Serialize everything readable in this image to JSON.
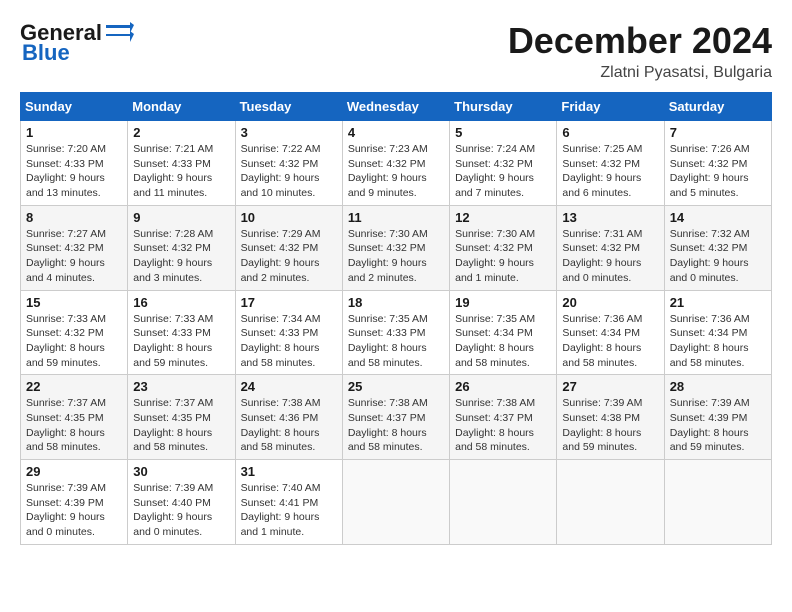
{
  "logo": {
    "line1": "General",
    "line2": "Blue"
  },
  "title": "December 2024",
  "location": "Zlatni Pyasatsi, Bulgaria",
  "days_of_week": [
    "Sunday",
    "Monday",
    "Tuesday",
    "Wednesday",
    "Thursday",
    "Friday",
    "Saturday"
  ],
  "weeks": [
    [
      {
        "day": "1",
        "info": "Sunrise: 7:20 AM\nSunset: 4:33 PM\nDaylight: 9 hours\nand 13 minutes."
      },
      {
        "day": "2",
        "info": "Sunrise: 7:21 AM\nSunset: 4:33 PM\nDaylight: 9 hours\nand 11 minutes."
      },
      {
        "day": "3",
        "info": "Sunrise: 7:22 AM\nSunset: 4:32 PM\nDaylight: 9 hours\nand 10 minutes."
      },
      {
        "day": "4",
        "info": "Sunrise: 7:23 AM\nSunset: 4:32 PM\nDaylight: 9 hours\nand 9 minutes."
      },
      {
        "day": "5",
        "info": "Sunrise: 7:24 AM\nSunset: 4:32 PM\nDaylight: 9 hours\nand 7 minutes."
      },
      {
        "day": "6",
        "info": "Sunrise: 7:25 AM\nSunset: 4:32 PM\nDaylight: 9 hours\nand 6 minutes."
      },
      {
        "day": "7",
        "info": "Sunrise: 7:26 AM\nSunset: 4:32 PM\nDaylight: 9 hours\nand 5 minutes."
      }
    ],
    [
      {
        "day": "8",
        "info": "Sunrise: 7:27 AM\nSunset: 4:32 PM\nDaylight: 9 hours\nand 4 minutes."
      },
      {
        "day": "9",
        "info": "Sunrise: 7:28 AM\nSunset: 4:32 PM\nDaylight: 9 hours\nand 3 minutes."
      },
      {
        "day": "10",
        "info": "Sunrise: 7:29 AM\nSunset: 4:32 PM\nDaylight: 9 hours\nand 2 minutes."
      },
      {
        "day": "11",
        "info": "Sunrise: 7:30 AM\nSunset: 4:32 PM\nDaylight: 9 hours\nand 2 minutes."
      },
      {
        "day": "12",
        "info": "Sunrise: 7:30 AM\nSunset: 4:32 PM\nDaylight: 9 hours\nand 1 minute."
      },
      {
        "day": "13",
        "info": "Sunrise: 7:31 AM\nSunset: 4:32 PM\nDaylight: 9 hours\nand 0 minutes."
      },
      {
        "day": "14",
        "info": "Sunrise: 7:32 AM\nSunset: 4:32 PM\nDaylight: 9 hours\nand 0 minutes."
      }
    ],
    [
      {
        "day": "15",
        "info": "Sunrise: 7:33 AM\nSunset: 4:32 PM\nDaylight: 8 hours\nand 59 minutes."
      },
      {
        "day": "16",
        "info": "Sunrise: 7:33 AM\nSunset: 4:33 PM\nDaylight: 8 hours\nand 59 minutes."
      },
      {
        "day": "17",
        "info": "Sunrise: 7:34 AM\nSunset: 4:33 PM\nDaylight: 8 hours\nand 58 minutes."
      },
      {
        "day": "18",
        "info": "Sunrise: 7:35 AM\nSunset: 4:33 PM\nDaylight: 8 hours\nand 58 minutes."
      },
      {
        "day": "19",
        "info": "Sunrise: 7:35 AM\nSunset: 4:34 PM\nDaylight: 8 hours\nand 58 minutes."
      },
      {
        "day": "20",
        "info": "Sunrise: 7:36 AM\nSunset: 4:34 PM\nDaylight: 8 hours\nand 58 minutes."
      },
      {
        "day": "21",
        "info": "Sunrise: 7:36 AM\nSunset: 4:34 PM\nDaylight: 8 hours\nand 58 minutes."
      }
    ],
    [
      {
        "day": "22",
        "info": "Sunrise: 7:37 AM\nSunset: 4:35 PM\nDaylight: 8 hours\nand 58 minutes."
      },
      {
        "day": "23",
        "info": "Sunrise: 7:37 AM\nSunset: 4:35 PM\nDaylight: 8 hours\nand 58 minutes."
      },
      {
        "day": "24",
        "info": "Sunrise: 7:38 AM\nSunset: 4:36 PM\nDaylight: 8 hours\nand 58 minutes."
      },
      {
        "day": "25",
        "info": "Sunrise: 7:38 AM\nSunset: 4:37 PM\nDaylight: 8 hours\nand 58 minutes."
      },
      {
        "day": "26",
        "info": "Sunrise: 7:38 AM\nSunset: 4:37 PM\nDaylight: 8 hours\nand 58 minutes."
      },
      {
        "day": "27",
        "info": "Sunrise: 7:39 AM\nSunset: 4:38 PM\nDaylight: 8 hours\nand 59 minutes."
      },
      {
        "day": "28",
        "info": "Sunrise: 7:39 AM\nSunset: 4:39 PM\nDaylight: 8 hours\nand 59 minutes."
      }
    ],
    [
      {
        "day": "29",
        "info": "Sunrise: 7:39 AM\nSunset: 4:39 PM\nDaylight: 9 hours\nand 0 minutes."
      },
      {
        "day": "30",
        "info": "Sunrise: 7:39 AM\nSunset: 4:40 PM\nDaylight: 9 hours\nand 0 minutes."
      },
      {
        "day": "31",
        "info": "Sunrise: 7:40 AM\nSunset: 4:41 PM\nDaylight: 9 hours\nand 1 minute."
      },
      null,
      null,
      null,
      null
    ]
  ]
}
